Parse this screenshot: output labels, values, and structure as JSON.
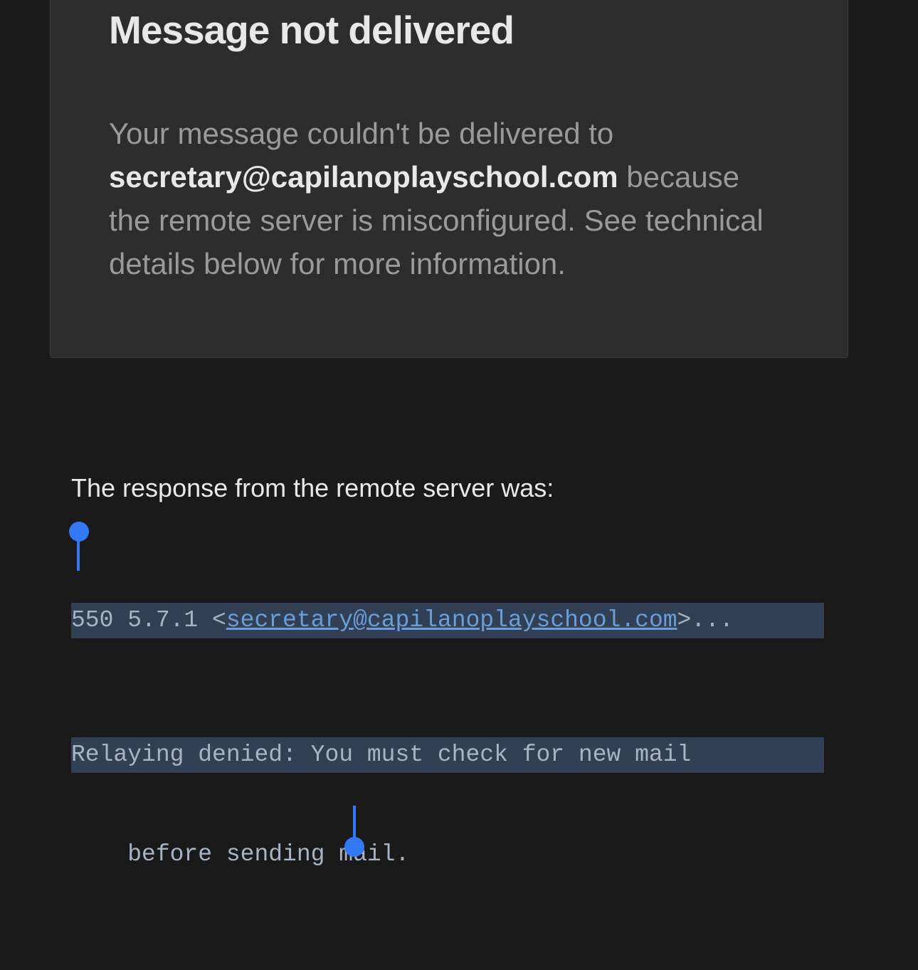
{
  "card": {
    "title": "Message not delivered",
    "body_prefix": "Your message couldn't be delivered to ",
    "body_email": "secretary@capilanoplayschool.com",
    "body_suffix": " because the remote server is misconfigured. See technical details below for more information."
  },
  "response": {
    "label": "The response from the remote server was:",
    "error_prefix": "550 5.7.1 <",
    "error_email": "secretary@capilanoplayschool.com",
    "error_suffix_1": ">... ",
    "error_line_2": "Relaying denied: You must check for new mail ",
    "error_line_3": "before sending mail."
  }
}
